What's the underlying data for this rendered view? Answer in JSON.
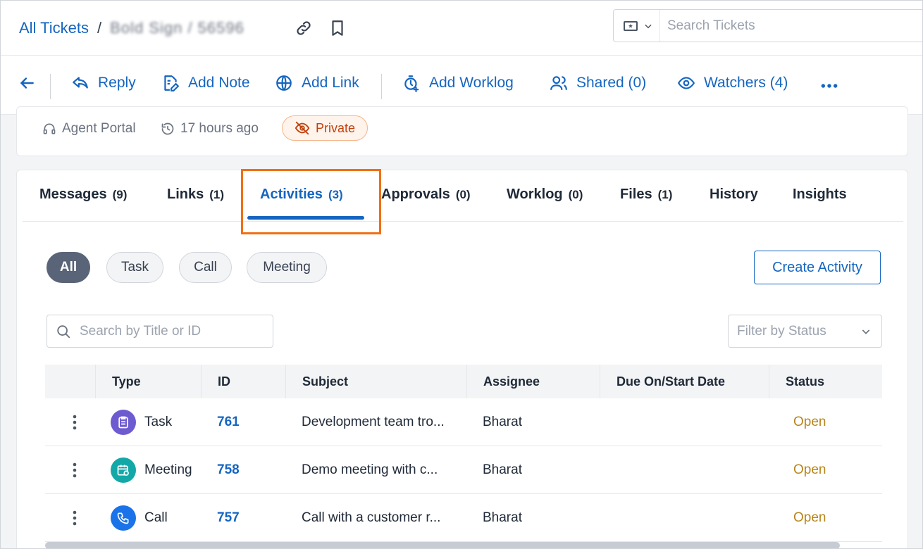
{
  "breadcrumb": {
    "root": "All Tickets",
    "separator": "/",
    "blurred": "Bold Sign / 56596"
  },
  "search": {
    "placeholder": "Search Tickets"
  },
  "toolbar": {
    "reply": "Reply",
    "add_note": "Add Note",
    "add_link": "Add Link",
    "add_worklog": "Add Worklog",
    "shared": "Shared (0)",
    "watchers": "Watchers (4)"
  },
  "info": {
    "source": "Agent Portal",
    "time": "17 hours ago",
    "visibility": "Private"
  },
  "tabs": [
    {
      "label": "Messages",
      "count": "(9)"
    },
    {
      "label": "Links",
      "count": "(1)"
    },
    {
      "label": "Activities",
      "count": "(3)"
    },
    {
      "label": "Approvals",
      "count": "(0)"
    },
    {
      "label": "Worklog",
      "count": "(0)"
    },
    {
      "label": "Files",
      "count": "(1)"
    },
    {
      "label": "History",
      "count": ""
    },
    {
      "label": "Insights",
      "count": ""
    }
  ],
  "filters": {
    "all": "All",
    "task": "Task",
    "call": "Call",
    "meeting": "Meeting"
  },
  "create_activity": "Create Activity",
  "search_title": {
    "placeholder": "Search by Title or ID"
  },
  "status_filter": {
    "placeholder": "Filter by Status"
  },
  "table": {
    "headers": {
      "type": "Type",
      "id": "ID",
      "subject": "Subject",
      "assignee": "Assignee",
      "due": "Due On/Start Date",
      "status": "Status"
    },
    "rows": [
      {
        "type": "Task",
        "id": "761",
        "subject": "Development team tro...",
        "assignee": "Bharat",
        "due": "",
        "status": "Open",
        "icon": "task-icon",
        "color": "#6d5bd0"
      },
      {
        "type": "Meeting",
        "id": "758",
        "subject": "Demo meeting with c...",
        "assignee": "Bharat",
        "due": "",
        "status": "Open",
        "icon": "meeting-icon",
        "color": "#13a8a8"
      },
      {
        "type": "Call",
        "id": "757",
        "subject": "Call with a customer r...",
        "assignee": "Bharat",
        "due": "",
        "status": "Open",
        "icon": "call-icon",
        "color": "#1a73e8"
      }
    ]
  },
  "colors": {
    "accent": "#1565c0",
    "highlight": "#f07014",
    "status_open": "#b7851a"
  }
}
